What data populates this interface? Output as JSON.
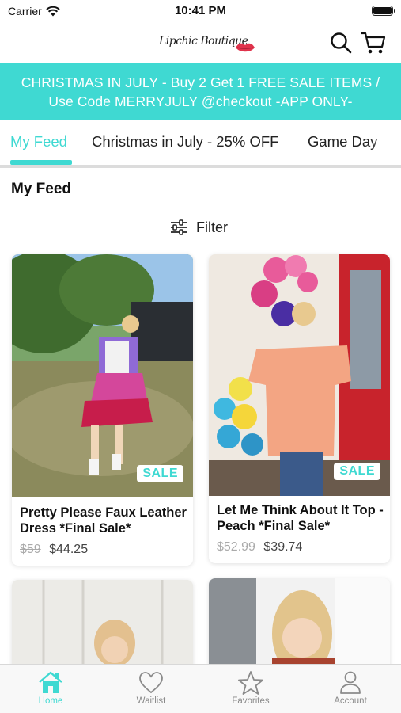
{
  "status_bar": {
    "carrier": "Carrier",
    "time": "10:41 PM"
  },
  "header": {
    "logo_text": "Lipchic Boutique"
  },
  "promo": {
    "line1": "CHRISTMAS IN JULY - Buy 2 Get 1 FREE SALE ITEMS /",
    "line2": "Use Code MERRYJULY @checkout -APP ONLY-"
  },
  "tabs": [
    {
      "label": "My Feed",
      "active": true
    },
    {
      "label": "Christmas in July - 25% OFF",
      "active": false
    },
    {
      "label": "Game Day",
      "active": false
    }
  ],
  "section_title": "My Feed",
  "filter_label": "Filter",
  "products": [
    {
      "name": "Pretty Please Faux Leather Dress *Final Sale*",
      "old_price": "$59",
      "price": "$44.25",
      "badge": "SALE"
    },
    {
      "name": "Let Me Think About It Top - Peach *Final Sale*",
      "old_price": "$52.99",
      "price": "$39.74",
      "badge": "SALE"
    }
  ],
  "bottom_nav": [
    {
      "label": "Home",
      "icon": "home-icon",
      "active": true
    },
    {
      "label": "Waitlist",
      "icon": "heart-icon",
      "active": false
    },
    {
      "label": "Favorites",
      "icon": "star-icon",
      "active": false
    },
    {
      "label": "Account",
      "icon": "person-icon",
      "active": false
    }
  ],
  "colors": {
    "accent": "#3fd9d2",
    "inactive": "#8a8a8a"
  }
}
